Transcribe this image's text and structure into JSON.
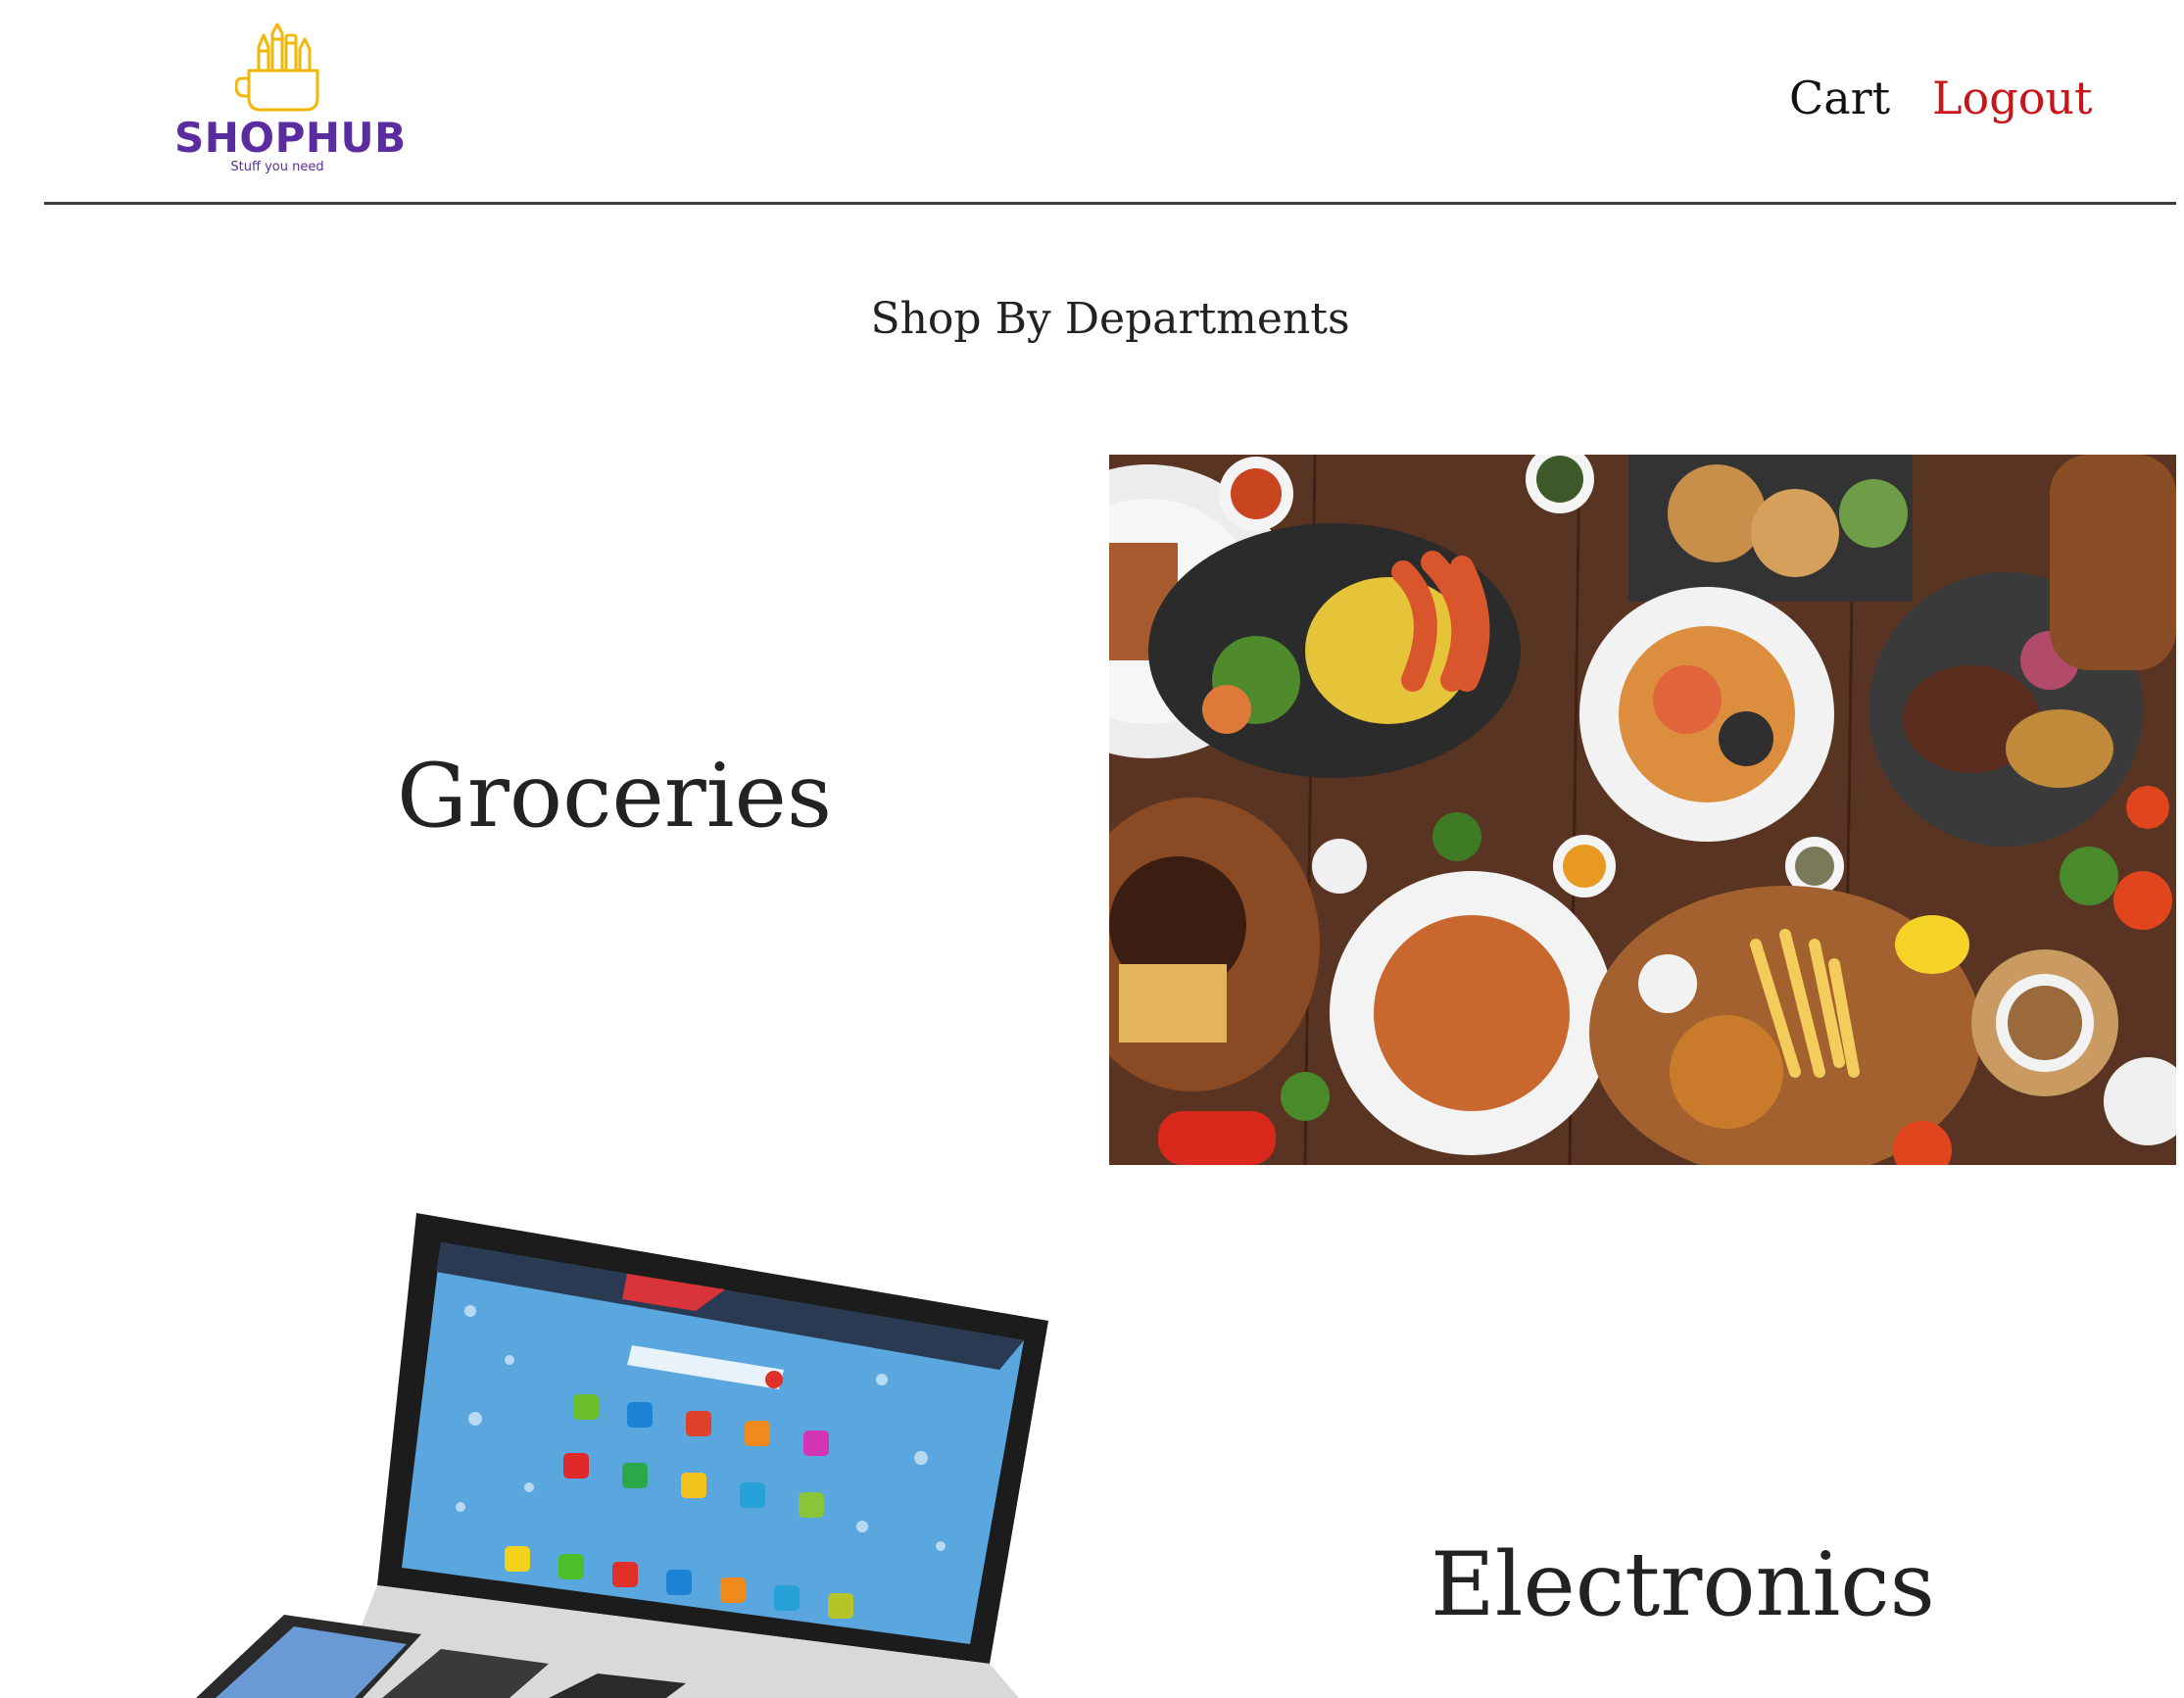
{
  "header": {
    "logo": {
      "brand": "SHOPHUB",
      "tagline": "Stuff you need",
      "icon": "pencil-cup-icon",
      "brand_color": "#5b2ca0",
      "icon_color": "#f2b705"
    },
    "nav": {
      "cart_label": "Cart",
      "logout_label": "Logout"
    }
  },
  "main": {
    "section_title": "Shop By Departments",
    "departments": [
      {
        "label": "Groceries",
        "image": "food-spread-photo"
      },
      {
        "label": "Electronics",
        "image": "laptop-devices-photo"
      }
    ]
  },
  "colors": {
    "text": "#222222",
    "logout": "#c8151b",
    "divider": "#3a3a3a",
    "background": "#ffffff"
  }
}
